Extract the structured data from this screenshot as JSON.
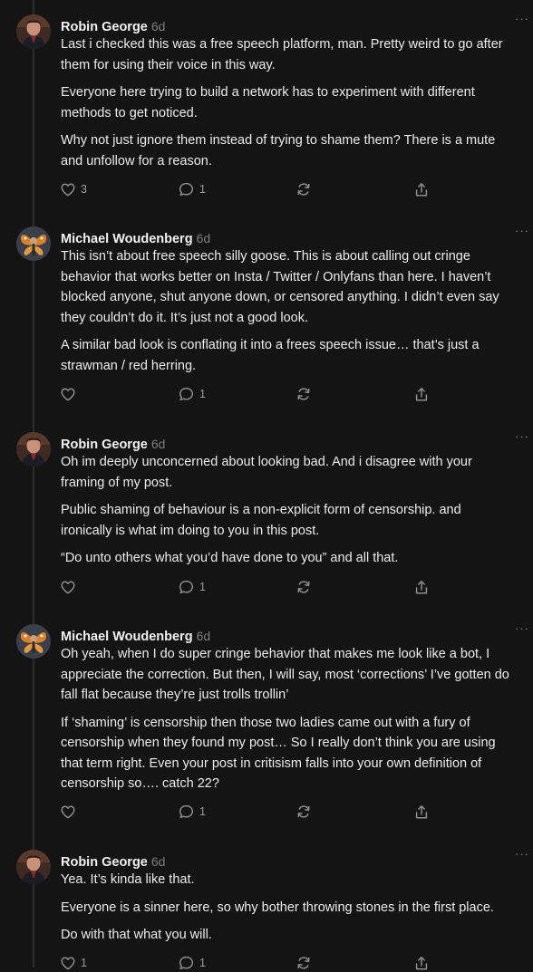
{
  "posts": [
    {
      "author": "Robin George",
      "time": "6d",
      "paragraphs": [
        [
          "Last i checked this was a free speech platform, man. Pretty weird to go after",
          "them for using their voice in this way."
        ],
        [
          "Everyone here trying to build a network has to experiment with different",
          "methods to get noticed."
        ],
        [
          "Why not just ignore them instead of trying to shame them? There is a mute",
          "and unfollow for a reason."
        ]
      ],
      "likes": "3",
      "replies": "1",
      "reposts": "",
      "avatar": "robin"
    },
    {
      "author": "Michael Woudenberg",
      "time": "6d",
      "paragraphs": [
        [
          "This isn’t about free speech silly goose. This is about calling out cringe",
          "behavior that works better on Insta / Twitter / Onlyfans than here. I haven’t",
          "blocked anyone, shut anyone down, or censored anything. I didn’t even say",
          "they couldn’t do it. It’s just not a good look."
        ],
        [
          "A similar bad look is conflating it into a frees speech issue… that’s just a",
          "strawman / red herring."
        ]
      ],
      "likes": "",
      "replies": "1",
      "reposts": "",
      "avatar": "michael"
    },
    {
      "author": "Robin George",
      "time": "6d",
      "paragraphs": [
        [
          "Oh im deeply unconcerned about looking bad. And i disagree with your",
          "framing of my post."
        ],
        [
          "Public shaming of behaviour is a non-explicit form of censorship. and",
          "ironically is what im doing to you in this post."
        ],
        [
          "“Do unto others what you’d have done to you” and all that."
        ]
      ],
      "likes": "",
      "replies": "1",
      "reposts": "",
      "avatar": "robin"
    },
    {
      "author": "Michael Woudenberg",
      "time": "6d",
      "paragraphs": [
        [
          "Oh yeah, when I do super cringe behavior that makes me look like a bot, I",
          "appreciate the correction. But then, I will say, most ‘corrections’ I’ve gotten do",
          "fall flat because they’re just trolls trollin’"
        ],
        [
          "If ‘shaming’ is censorship then those two ladies came out with a fury of",
          "censorship when they found my post… So I really don’t think you are using",
          "that term right. Even your post in critisism falls into your own definition of",
          "censorship so…. catch 22?"
        ]
      ],
      "likes": "",
      "replies": "1",
      "reposts": "",
      "avatar": "michael"
    },
    {
      "author": "Robin George",
      "time": "6d",
      "paragraphs": [
        [
          "Yea. It’s kinda like that."
        ],
        [
          "Everyone is a sinner here, so why bother throwing stones in the first place."
        ],
        [
          "Do with that what you will."
        ]
      ],
      "likes": "1",
      "replies": "1",
      "reposts": "",
      "avatar": "robin"
    }
  ],
  "icons": {
    "like": "heart-icon",
    "reply": "comment-bubble-icon",
    "repost": "repost-icon",
    "share": "share-icon",
    "more": "more-options-icon"
  },
  "more_label": "···",
  "colors": {
    "background": "#141414",
    "text": "#ececec",
    "muted": "#7d7d7d",
    "icon": "#8c8c8c"
  }
}
